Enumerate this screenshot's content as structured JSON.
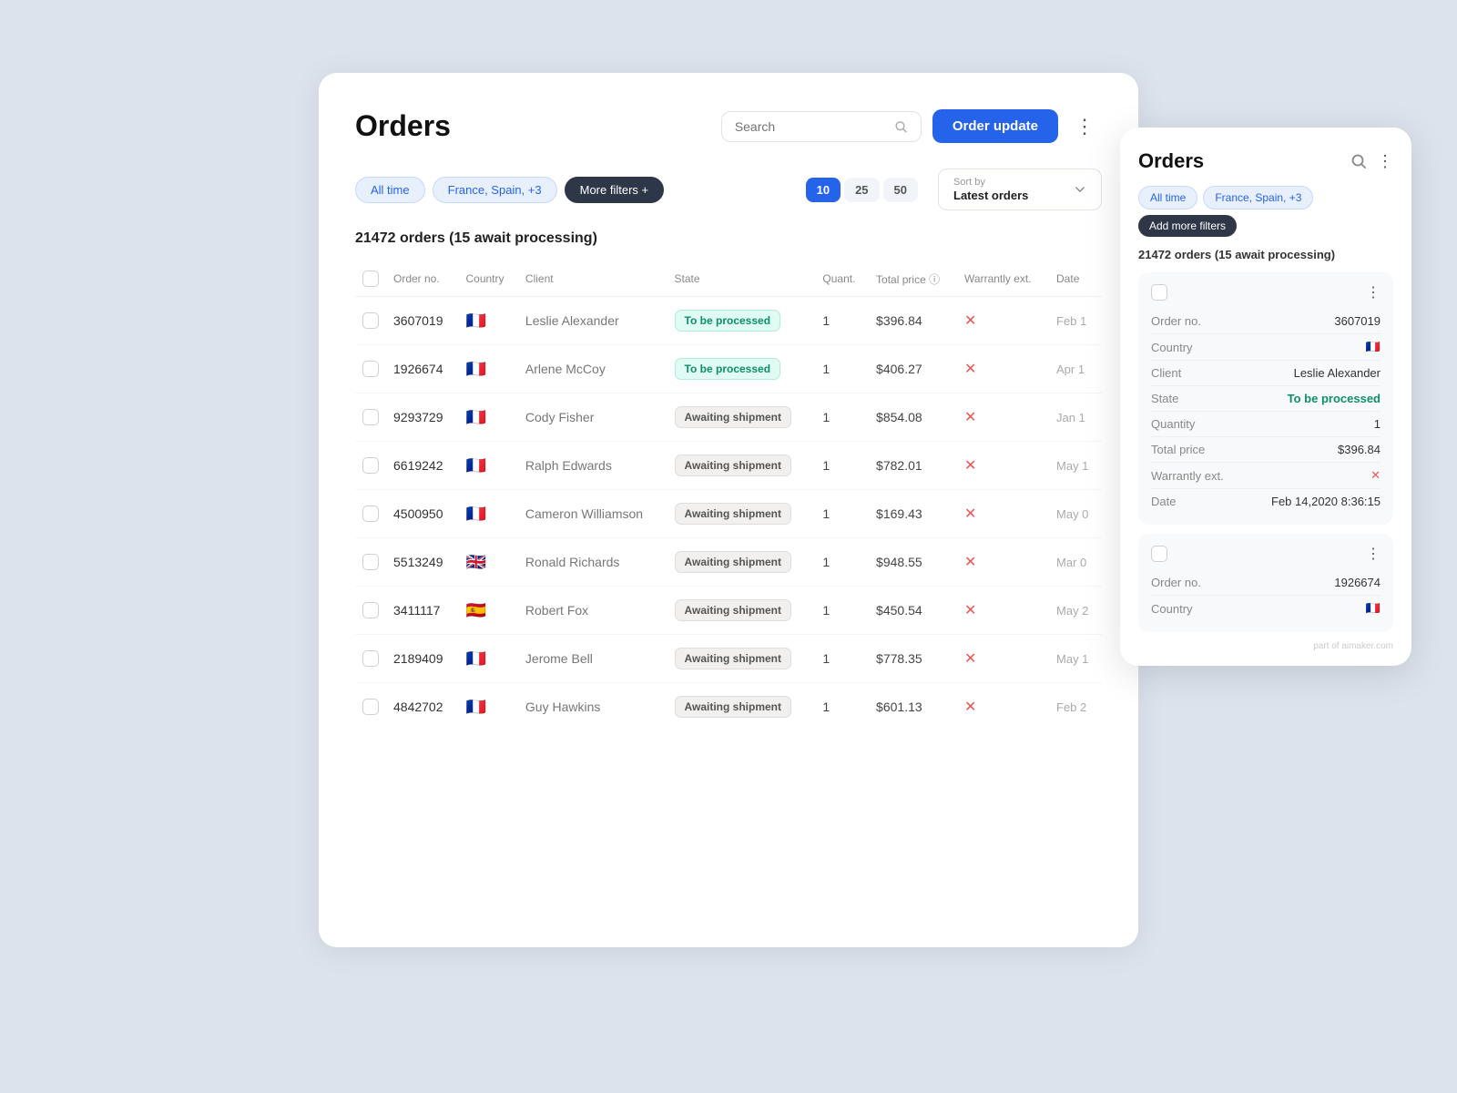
{
  "page": {
    "title": "Orders",
    "search_placeholder": "Search",
    "order_update_btn": "Order update",
    "summary": "21472 orders (15 await processing)"
  },
  "filters": {
    "all_time": "All time",
    "countries": "France, Spain, +3",
    "more_filters": "More filters",
    "more_filters_icon": "+"
  },
  "pagination": {
    "sizes": [
      "10",
      "25",
      "50"
    ],
    "active": "10"
  },
  "sort": {
    "label": "Sort by",
    "value": "Latest orders"
  },
  "table": {
    "headers": [
      "",
      "Order no.",
      "Country",
      "Client",
      "State",
      "Quant.",
      "Total price",
      "Warranty ext.",
      "Date"
    ],
    "rows": [
      {
        "id": "3607019",
        "country_flag": "🇫🇷",
        "country_code": "FR",
        "client": "Leslie Alexander",
        "state": "To be processed",
        "state_type": "to-process",
        "quantity": "1",
        "total_price": "$396.84",
        "warranty": "x",
        "date": "Feb 1"
      },
      {
        "id": "1926674",
        "country_flag": "🇫🇷",
        "country_code": "FR",
        "client": "Arlene McCoy",
        "state": "To be processed",
        "state_type": "to-process",
        "quantity": "1",
        "total_price": "$406.27",
        "warranty": "x",
        "date": "Apr 1"
      },
      {
        "id": "9293729",
        "country_flag": "🇫🇷",
        "country_code": "FR",
        "client": "Cody Fisher",
        "state": "Awaiting shipment",
        "state_type": "awaiting",
        "quantity": "1",
        "total_price": "$854.08",
        "warranty": "x",
        "date": "Jan 1"
      },
      {
        "id": "6619242",
        "country_flag": "🇫🇷",
        "country_code": "FR",
        "client": "Ralph Edwards",
        "state": "Awaiting shipment",
        "state_type": "awaiting",
        "quantity": "1",
        "total_price": "$782.01",
        "warranty": "x",
        "date": "May 1"
      },
      {
        "id": "4500950",
        "country_flag": "🇫🇷",
        "country_code": "FR",
        "client": "Cameron Williamson",
        "state": "Awaiting shipment",
        "state_type": "awaiting",
        "quantity": "1",
        "total_price": "$169.43",
        "warranty": "x",
        "date": "May 0"
      },
      {
        "id": "5513249",
        "country_flag": "🇬🇧",
        "country_code": "GB",
        "client": "Ronald Richards",
        "state": "Awaiting shipment",
        "state_type": "awaiting",
        "quantity": "1",
        "total_price": "$948.55",
        "warranty": "x",
        "date": "Mar 0"
      },
      {
        "id": "3411117",
        "country_flag": "🇪🇸",
        "country_code": "ES",
        "client": "Robert Fox",
        "state": "Awaiting shipment",
        "state_type": "awaiting",
        "quantity": "1",
        "total_price": "$450.54",
        "warranty": "x",
        "date": "May 2"
      },
      {
        "id": "2189409",
        "country_flag": "🇫🇷",
        "country_code": "FR",
        "client": "Jerome Bell",
        "state": "Awaiting shipment",
        "state_type": "awaiting",
        "quantity": "1",
        "total_price": "$778.35",
        "warranty": "x",
        "date": "May 1"
      },
      {
        "id": "4842702",
        "country_flag": "🇫🇷",
        "country_code": "FR",
        "client": "Guy Hawkins",
        "state": "Awaiting shipment",
        "state_type": "awaiting",
        "quantity": "1",
        "total_price": "$601.13",
        "warranty": "x",
        "date": "Feb 2"
      }
    ]
  },
  "side_panel": {
    "title": "Orders",
    "filters": {
      "all_time": "All time",
      "countries": "France, Spain, +3",
      "add_filters": "Add more filters"
    },
    "summary": "21472 orders (15 await processing)",
    "records": [
      {
        "order_no_label": "Order no.",
        "order_no_value": "3607019",
        "country_label": "Country",
        "country_flag": "🇫🇷",
        "client_label": "Client",
        "client_value": "Leslie Alexander",
        "state_label": "State",
        "state_value": "To be processed",
        "quantity_label": "Quantity",
        "quantity_value": "1",
        "total_price_label": "Total price",
        "total_price_value": "$396.84",
        "warranty_label": "Warrantly ext.",
        "warranty_value": "x",
        "date_label": "Date",
        "date_value": "Feb 14,2020 8:36:15"
      },
      {
        "order_no_label": "Order no.",
        "order_no_value": "1926674",
        "country_label": "Country",
        "country_flag": "🇫🇷"
      }
    ],
    "watermark": "part of aimaker.com"
  }
}
